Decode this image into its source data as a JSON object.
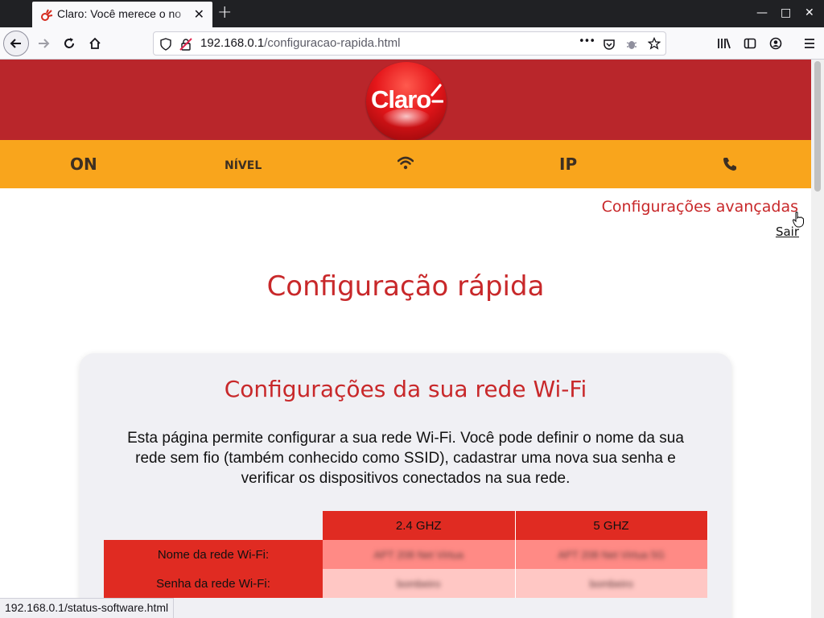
{
  "browser": {
    "tab_title": "Claro: Você merece o no",
    "new_tab_symbol": "+",
    "url_host": "192.168.0.1",
    "url_path": "/configuracao-rapida.html",
    "status_url": "192.168.0.1/status-software.html",
    "more_symbol": "•••"
  },
  "header": {
    "logo_text": "Claro",
    "nav": [
      {
        "label": "ON"
      },
      {
        "label": "NÍVEL"
      },
      {
        "label": "",
        "icon": "wifi-icon"
      },
      {
        "label": "IP"
      },
      {
        "label": "",
        "icon": "phone-icon"
      }
    ]
  },
  "links": {
    "advanced": "Configurações avançadas",
    "logout": "Sair"
  },
  "main": {
    "title": "Configuração rápida",
    "card": {
      "title": "Configurações da sua rede Wi-Fi",
      "description": "Esta página permite configurar a sua rede Wi-Fi. Você pode definir o nome da sua rede sem fio (também conhecido como SSID), cadastrar uma nova sua senha e verificar os dispositivos conectados na sua rede.",
      "table": {
        "columns": [
          "2.4 GHZ",
          "5 GHZ"
        ],
        "rows": [
          {
            "label": "Nome da rede Wi-Fi:",
            "v24": "APT 208 Net Virtua",
            "v5": "APT 208 Net Virtua 5G"
          },
          {
            "label": "Senha da rede Wi-Fi:",
            "v24": "bombeiro",
            "v5": "bombeiro"
          }
        ]
      }
    }
  },
  "colors": {
    "brand_red": "#b9262b",
    "accent_orange": "#f9a51c",
    "title_red": "#c8282a"
  }
}
